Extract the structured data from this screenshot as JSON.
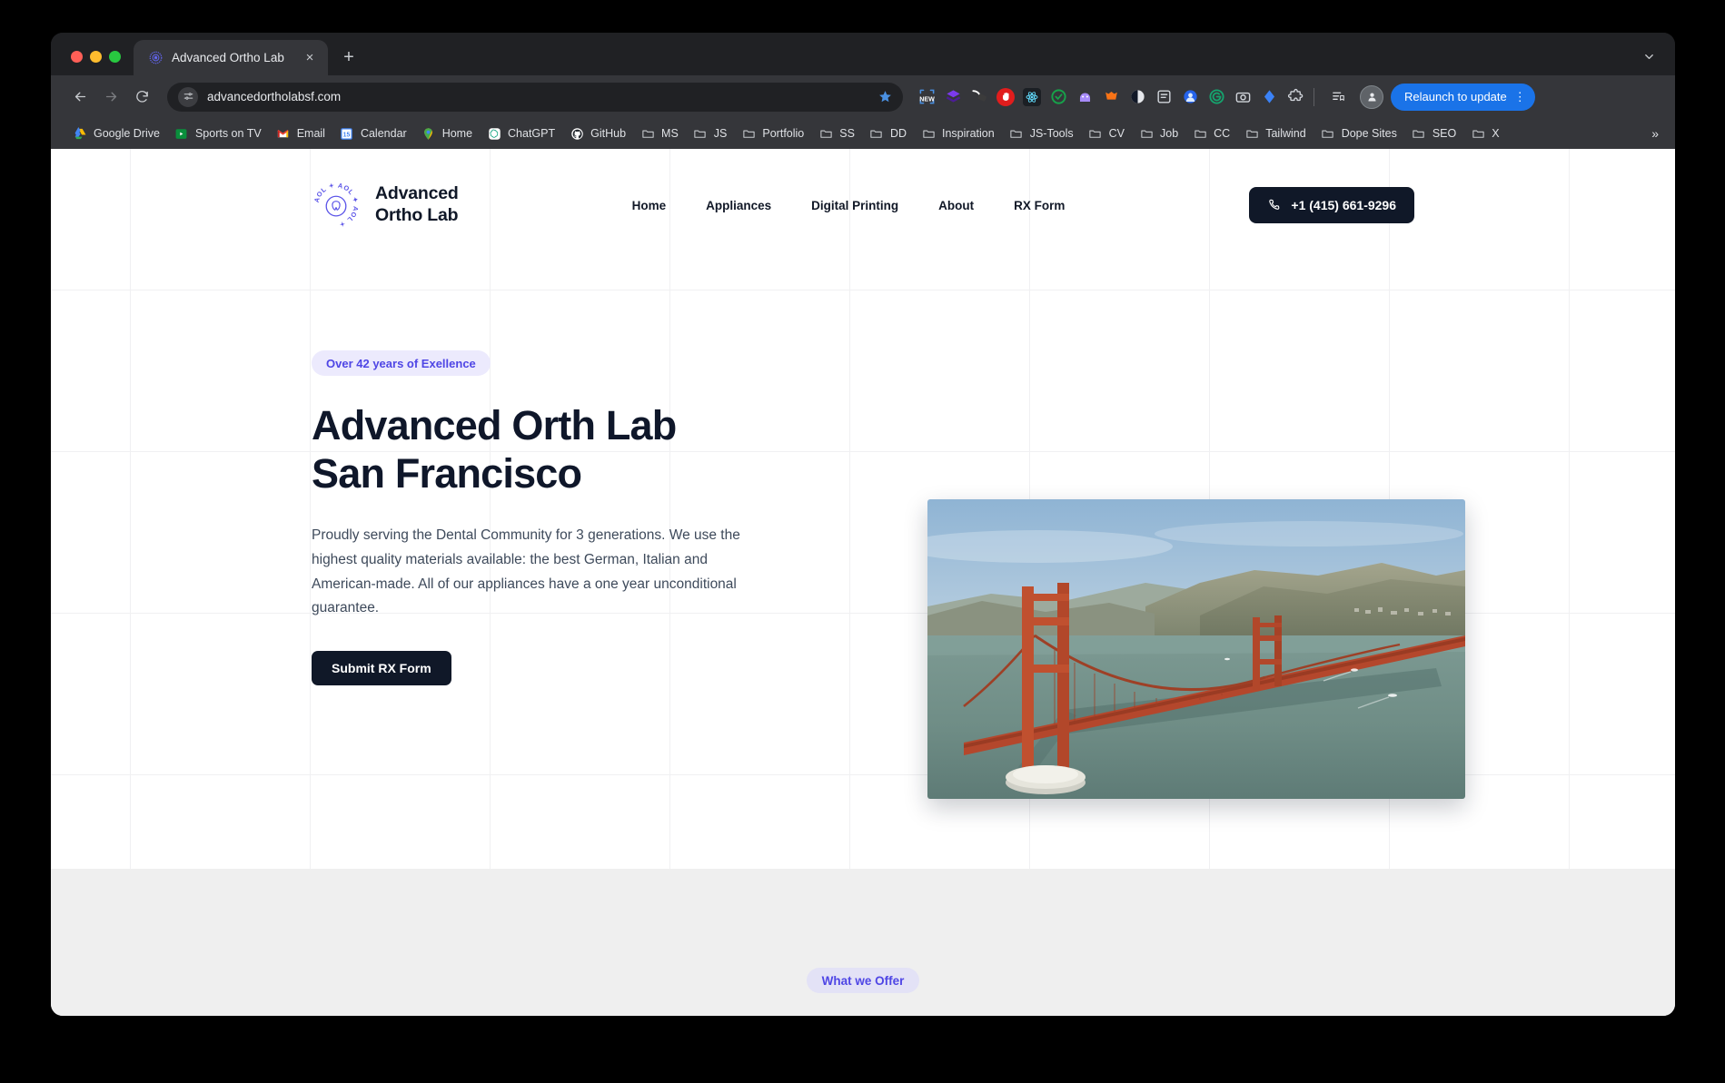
{
  "browser": {
    "tab": {
      "title": "Advanced Ortho Lab",
      "favicon": "site-logo-favicon",
      "close_label": "×"
    },
    "new_tab_label": "+",
    "omnibox": {
      "url": "advancedortholabsf.com",
      "permission_icon": "tune-icon",
      "bookmark_icon": "star-filled-icon"
    },
    "nav": {
      "back": "←",
      "forward": "→",
      "reload": "↻"
    },
    "extensions": [
      {
        "name": "new-badge-extension",
        "label": "NEW"
      },
      {
        "name": "purple-layers-extension",
        "label": ""
      },
      {
        "name": "pickaxe-extension",
        "label": ""
      },
      {
        "name": "adblock-extension",
        "label": ""
      },
      {
        "name": "react-devtools-extension",
        "label": ""
      },
      {
        "name": "green-circle-extension",
        "label": ""
      },
      {
        "name": "purple-blob-extension",
        "label": ""
      },
      {
        "name": "orange-fox-extension",
        "label": ""
      },
      {
        "name": "dark-circle-extension",
        "label": ""
      },
      {
        "name": "note-extension",
        "label": ""
      },
      {
        "name": "blue-avatar-extension",
        "label": ""
      },
      {
        "name": "grammarly-extension",
        "label": "G"
      },
      {
        "name": "camera-extension",
        "label": ""
      },
      {
        "name": "diamond-extension",
        "label": ""
      },
      {
        "name": "puzzle-extensions-menu",
        "label": ""
      }
    ],
    "reading_list_icon": "reading-list-icon",
    "profile_icon": "profile-avatar-icon",
    "relaunch": {
      "label": "Relaunch to update",
      "menu": "⋮"
    },
    "bookmarks": [
      {
        "label": "Google Drive",
        "icon": "google-drive-icon"
      },
      {
        "label": "Sports on TV",
        "icon": "sports-on-tv-icon"
      },
      {
        "label": "Email",
        "icon": "gmail-icon"
      },
      {
        "label": "Calendar",
        "icon": "google-calendar-icon"
      },
      {
        "label": "Home",
        "icon": "google-maps-pin-icon"
      },
      {
        "label": "ChatGPT",
        "icon": "chatgpt-icon"
      },
      {
        "label": "GitHub",
        "icon": "github-icon"
      },
      {
        "label": "MS",
        "icon": "folder-icon"
      },
      {
        "label": "JS",
        "icon": "folder-icon"
      },
      {
        "label": "Portfolio",
        "icon": "folder-icon"
      },
      {
        "label": "SS",
        "icon": "folder-icon"
      },
      {
        "label": "DD",
        "icon": "folder-icon"
      },
      {
        "label": "Inspiration",
        "icon": "folder-icon"
      },
      {
        "label": "JS-Tools",
        "icon": "folder-icon"
      },
      {
        "label": "CV",
        "icon": "folder-icon"
      },
      {
        "label": "Job",
        "icon": "folder-icon"
      },
      {
        "label": "CC",
        "icon": "folder-icon"
      },
      {
        "label": "Tailwind",
        "icon": "folder-icon"
      },
      {
        "label": "Dope Sites",
        "icon": "folder-icon"
      },
      {
        "label": "SEO",
        "icon": "folder-icon"
      },
      {
        "label": "X",
        "icon": "folder-icon"
      }
    ],
    "bookmarks_overflow": "»"
  },
  "site": {
    "brand": {
      "name_line1": "Advanced",
      "name_line2": "Ortho Lab",
      "mark_text": "AOL",
      "mark_icon": "tooth-badge-logo"
    },
    "nav": [
      {
        "label": "Home"
      },
      {
        "label": "Appliances"
      },
      {
        "label": "Digital Printing"
      },
      {
        "label": "About"
      },
      {
        "label": "RX Form"
      }
    ],
    "phone": {
      "label": "+1 (415) 661-9296",
      "icon": "phone-icon"
    },
    "hero": {
      "badge": "Over 42 years of Exellence",
      "title": "Advanced Orth Lab\nSan Francisco",
      "body": "Proudly serving the Dental Community for 3 generations. We use the highest quality materials available: the best German, Italian and American-made. All of our appliances have a one year unconditional guarantee.",
      "cta": "Submit RX Form",
      "image_alt": "golden-gate-bridge-aerial-photo"
    },
    "offer": {
      "pill": "What we Offer"
    },
    "colors": {
      "accent": "#4f46e5",
      "badge_bg": "#eceafd",
      "dark": "#101828",
      "band_bg": "#efefef"
    }
  }
}
